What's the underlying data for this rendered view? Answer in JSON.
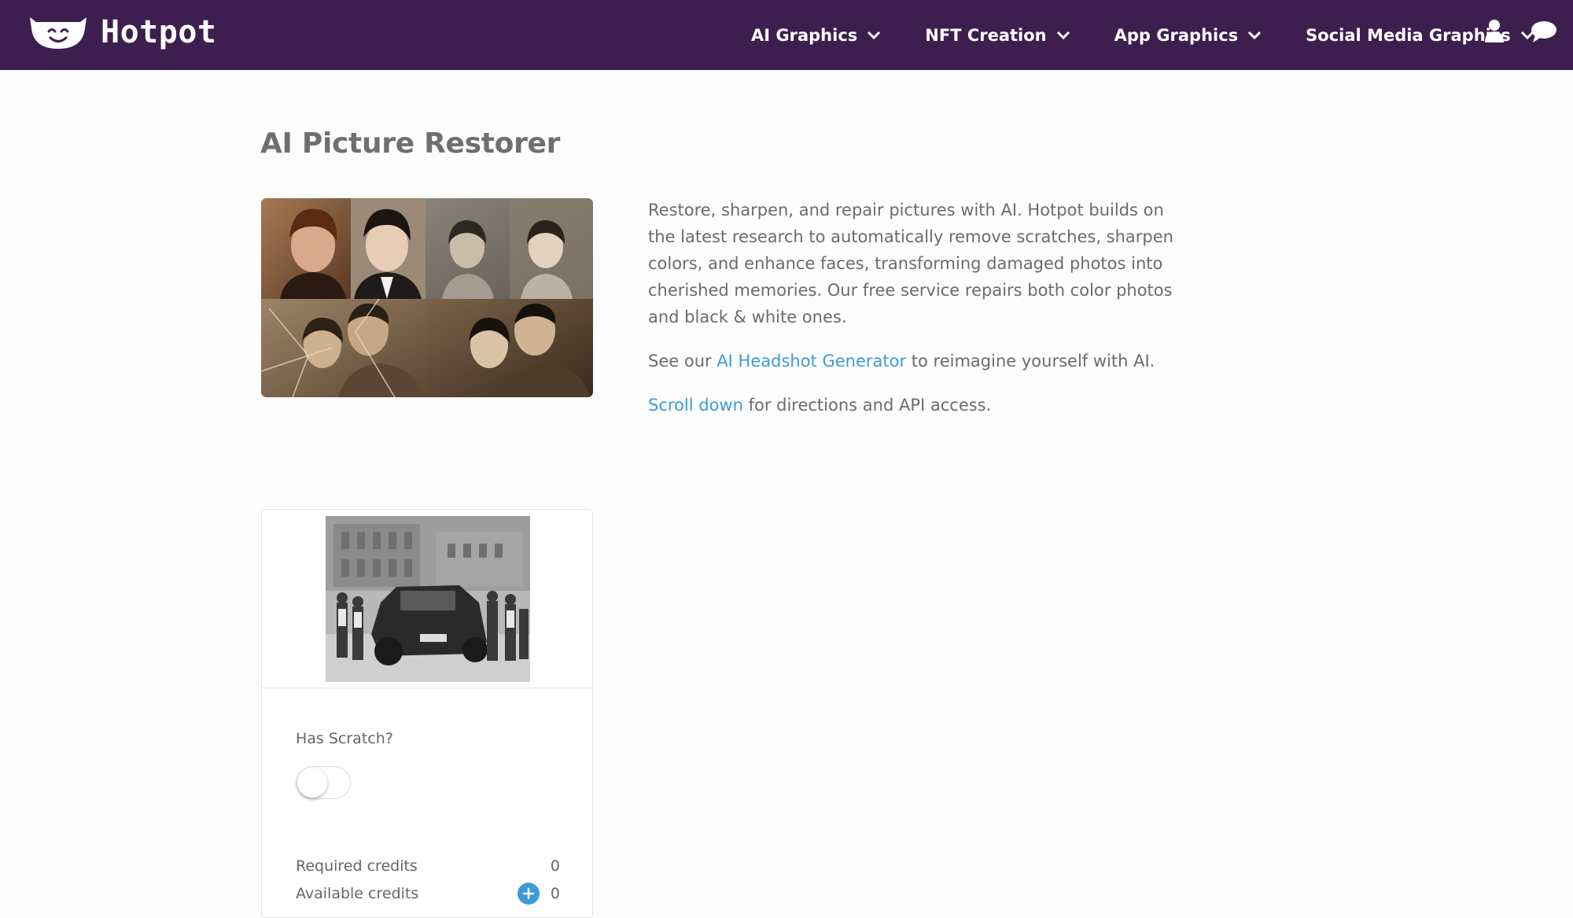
{
  "navbar": {
    "brand": "Hotpot",
    "items": [
      {
        "label": "AI Graphics"
      },
      {
        "label": "NFT Creation"
      },
      {
        "label": "App Graphics"
      },
      {
        "label": "Social Media Graphics"
      }
    ],
    "icons": [
      "user-icon",
      "chat-bubble-icon"
    ]
  },
  "main": {
    "title": "AI Picture Restorer",
    "intro_text": "Restore, sharpen, and repair pictures with AI. Hotpot builds on the latest research to automatically remove scratches, sharpen colors, and enhance faces, transforming damaged photos into cherished memories. Our free service repairs both color photos and black & white ones.",
    "see_our_prefix": "See our ",
    "headshot_link": "AI Headshot Generator",
    "see_our_suffix": " to reimagine yourself with AI.",
    "scroll_link": "Scroll down",
    "scroll_suffix": " for directions and API access."
  },
  "card": {
    "scratch_label": "Has Scratch?",
    "scratch_enabled": false,
    "required_credits_label": "Required credits",
    "required_credits_value": "0",
    "available_credits_label": "Available credits",
    "available_credits_value": "0",
    "add_credits_icon": "plus-icon"
  },
  "colors": {
    "navbar_bg": "#3c1f4f",
    "link": "#3d9ad8",
    "text": "#6b6b6b"
  }
}
